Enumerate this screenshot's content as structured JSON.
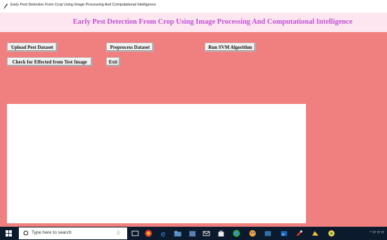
{
  "window": {
    "title": "Early Pest Detection From Crop Using Image Processing And Computational Intelligence"
  },
  "header": {
    "heading": "Early Pest Detection From Crop Using Image Processing And Computational Intelligence"
  },
  "buttons": {
    "upload": "Upload Pest Dataset",
    "preprocess": "Preprocess Dataset",
    "svm": "Run SVM Algorithm",
    "check": "Check for Effected from Test Image",
    "exit": "Exit"
  },
  "output": {
    "text": ""
  },
  "taskbar": {
    "search_placeholder": "Type here to search",
    "icons": [
      "microphone-icon",
      "task-view-icon",
      "chrome-icon",
      "edge-icon",
      "file-explorer-icon",
      "store-icon",
      "mail-icon",
      "shopping-icon",
      "chrome-icon",
      "paint-icon",
      "files-icon",
      "outlook-icon",
      "tool-icon",
      "drive-icon",
      "app-icon"
    ],
    "tray_text": "^ ⁇ ⁇ ⁇"
  },
  "colors": {
    "background": "#f08080",
    "header_bg": "#fde6ef",
    "heading": "#c04fd8",
    "taskbar": "#0b1a2c"
  }
}
